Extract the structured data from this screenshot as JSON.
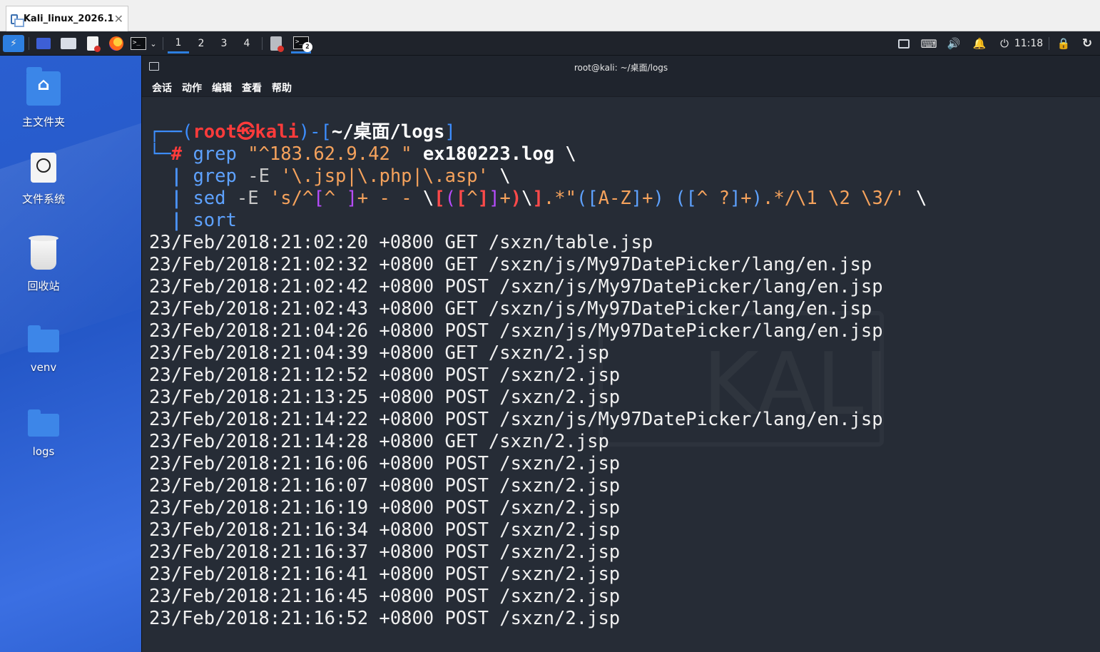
{
  "host": {
    "tab_title": "Kali_linux_2026.1",
    "tab_close": "✕"
  },
  "panel": {
    "workspaces": [
      "1",
      "2",
      "3",
      "4"
    ],
    "active_workspace": "1",
    "terminal_badge": "2",
    "clock": "11:18"
  },
  "desktop": {
    "icons": [
      {
        "label": "主文件夹"
      },
      {
        "label": "文件系统"
      },
      {
        "label": "回收站"
      },
      {
        "label": "venv"
      },
      {
        "label": "logs"
      }
    ]
  },
  "terminal": {
    "title": "root@kali: ~/桌面/logs",
    "menu": [
      "会话",
      "动作",
      "编辑",
      "查看",
      "帮助"
    ],
    "prompt": {
      "user": "root",
      "skull": "㉿",
      "host": "kali",
      "path": "~/桌面/logs",
      "hash": "#"
    },
    "command": {
      "l1_cmd": "grep",
      "l1_str": "\"^183.62.9.42 \"",
      "l1_file": "ex180223.log",
      "cont": "\\",
      "pipe": "|",
      "l2_cmd": "grep",
      "l2_opt": "-E",
      "l2_str": "'\\.jsp|\\.php|\\.asp'",
      "l3_cmd": "sed",
      "l3_opt": "-E",
      "l4_cmd": "sort"
    },
    "output": [
      "23/Feb/2018:21:02:20 +0800 GET /sxzn/table.jsp",
      "23/Feb/2018:21:02:32 +0800 GET /sxzn/js/My97DatePicker/lang/en.jsp",
      "23/Feb/2018:21:02:42 +0800 POST /sxzn/js/My97DatePicker/lang/en.jsp",
      "23/Feb/2018:21:02:43 +0800 GET /sxzn/js/My97DatePicker/lang/en.jsp",
      "23/Feb/2018:21:04:26 +0800 POST /sxzn/js/My97DatePicker/lang/en.jsp",
      "23/Feb/2018:21:04:39 +0800 GET /sxzn/2.jsp",
      "23/Feb/2018:21:12:52 +0800 POST /sxzn/2.jsp",
      "23/Feb/2018:21:13:25 +0800 POST /sxzn/2.jsp",
      "23/Feb/2018:21:14:22 +0800 POST /sxzn/js/My97DatePicker/lang/en.jsp",
      "23/Feb/2018:21:14:28 +0800 GET /sxzn/2.jsp",
      "23/Feb/2018:21:16:06 +0800 POST /sxzn/2.jsp",
      "23/Feb/2018:21:16:07 +0800 POST /sxzn/2.jsp",
      "23/Feb/2018:21:16:19 +0800 POST /sxzn/2.jsp",
      "23/Feb/2018:21:16:34 +0800 POST /sxzn/2.jsp",
      "23/Feb/2018:21:16:37 +0800 POST /sxzn/2.jsp",
      "23/Feb/2018:21:16:41 +0800 POST /sxzn/2.jsp",
      "23/Feb/2018:21:16:45 +0800 POST /sxzn/2.jsp",
      "23/Feb/2018:21:16:52 +0800 POST /sxzn/2.jsp"
    ],
    "watermark": "KALI"
  },
  "colors": {
    "accent": "#2d7fe0",
    "terminal_bg": "#262c36",
    "prompt_red": "#ff3b3b",
    "prompt_blue": "#3d8eff"
  }
}
